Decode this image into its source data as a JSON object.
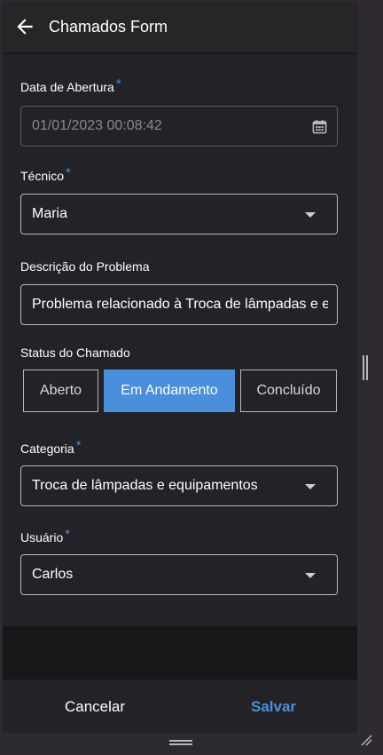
{
  "header": {
    "title": "Chamados Form",
    "back_icon": "arrow-left-icon"
  },
  "form": {
    "data_abertura": {
      "label": "Data de Abertura",
      "required_mark": "*",
      "value": "01/01/2023 00:08:42",
      "icon": "calendar-icon"
    },
    "tecnico": {
      "label": "Técnico",
      "required_mark": "*",
      "value": "Maria"
    },
    "descricao": {
      "label": "Descrição do Problema",
      "value": "Problema relacionado à Troca de lâmpadas e equipamentos"
    },
    "status": {
      "label": "Status do Chamado",
      "options": [
        "Aberto",
        "Em Andamento",
        "Concluído"
      ],
      "selected": "Em Andamento"
    },
    "categoria": {
      "label": "Categoria",
      "required_mark": "*",
      "value": "Troca de lâmpadas e equipamentos"
    },
    "usuario": {
      "label": "Usuário",
      "required_mark": "*",
      "value": "Carlos"
    }
  },
  "footer": {
    "cancel_label": "Cancelar",
    "save_label": "Salvar"
  },
  "colors": {
    "accent": "#4a8fdb",
    "background": "#232226",
    "required": "#3d8fe0"
  }
}
